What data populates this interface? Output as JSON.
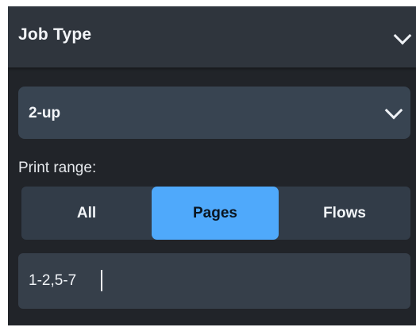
{
  "section": {
    "title": "Job Type",
    "icon": "chevron-down-icon"
  },
  "job_type_select": {
    "selected": "2-up",
    "icon": "chevron-down-icon"
  },
  "print_range": {
    "label": "Print range:",
    "options": [
      "All",
      "Pages",
      "Flows"
    ],
    "selected": "Pages"
  },
  "pages_input": {
    "value": "1-2,5-7"
  },
  "colors": {
    "panel_background": "#212429",
    "header_background": "#2f353d",
    "control_background": "#384451",
    "selected_accent": "#4fa9fb",
    "text": "#f2f4f7"
  }
}
